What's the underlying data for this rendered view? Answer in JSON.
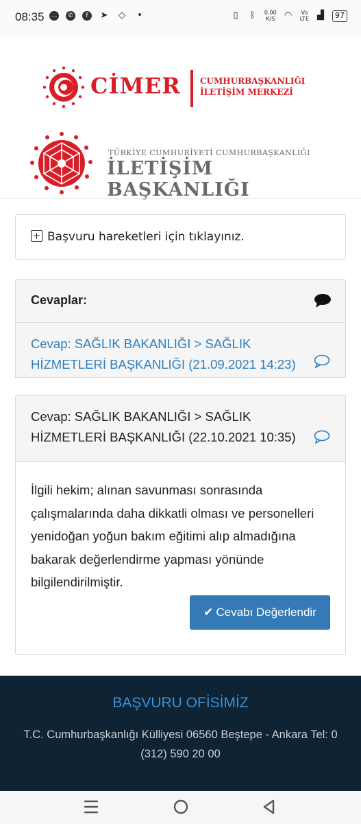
{
  "status_bar": {
    "time": "08:35",
    "speed": "0,00\nK/S",
    "network": "Vo\nLTE",
    "battery": "97"
  },
  "header": {
    "cimer_word": "CİMER",
    "cimer_sub_line1": "CUMHURBAŞKANLIĞI",
    "cimer_sub_line2": "İLETİŞİM MERKEZİ",
    "iletisim_top": "TÜRKİYE CUMHURİYETİ CUMHURBAŞKANLIĞI",
    "iletisim_main": "İLETİŞİM BAŞKANLIĞI"
  },
  "movements": {
    "label": "Başvuru hareketleri için tıklayınız."
  },
  "answers": {
    "title": "Cevaplar:",
    "items": [
      {
        "label": "Cevap: SAĞLIK BAKANLIĞI > SAĞLIK HİZMETLERİ BAŞKANLIĞI (21.09.2021 14:23)"
      },
      {
        "label": "Cevap: SAĞLIK BAKANLIĞI > SAĞLIK HİZMETLERİ BAŞKANLIĞI (22.10.2021 10:35)"
      }
    ],
    "body": "İlgili hekim;  alınan savunması sonrasında çalışmalarında daha dikkatli olması ve personelleri yenidoğan yoğun bakım eğitimi alıp almadığına bakarak değerlendirme yapması yönünde bilgilendirilmiştir.",
    "rate_button": "Cevabı Değerlendir"
  },
  "footer": {
    "title": "BAŞVURU OFİSİMİZ",
    "address": "T.C. Cumhurbaşkanlığı Külliyesi 06560 Beştepe - Ankara Tel: 0 (312) 590 20 00"
  },
  "colors": {
    "brand_red": "#d81e27",
    "link_blue": "#2e7fbf",
    "button_blue": "#337ab7",
    "footer_bg": "#0e2333"
  },
  "icons": [
    "chat-icon",
    "whatsapp-icon",
    "facebook-icon",
    "telegram-icon",
    "bluetooth-icon",
    "wifi-icon",
    "signal-icon",
    "plus-square-icon",
    "comment-icon",
    "comment-outline-icon",
    "check-icon",
    "menu-icon",
    "home-icon",
    "back-icon"
  ]
}
